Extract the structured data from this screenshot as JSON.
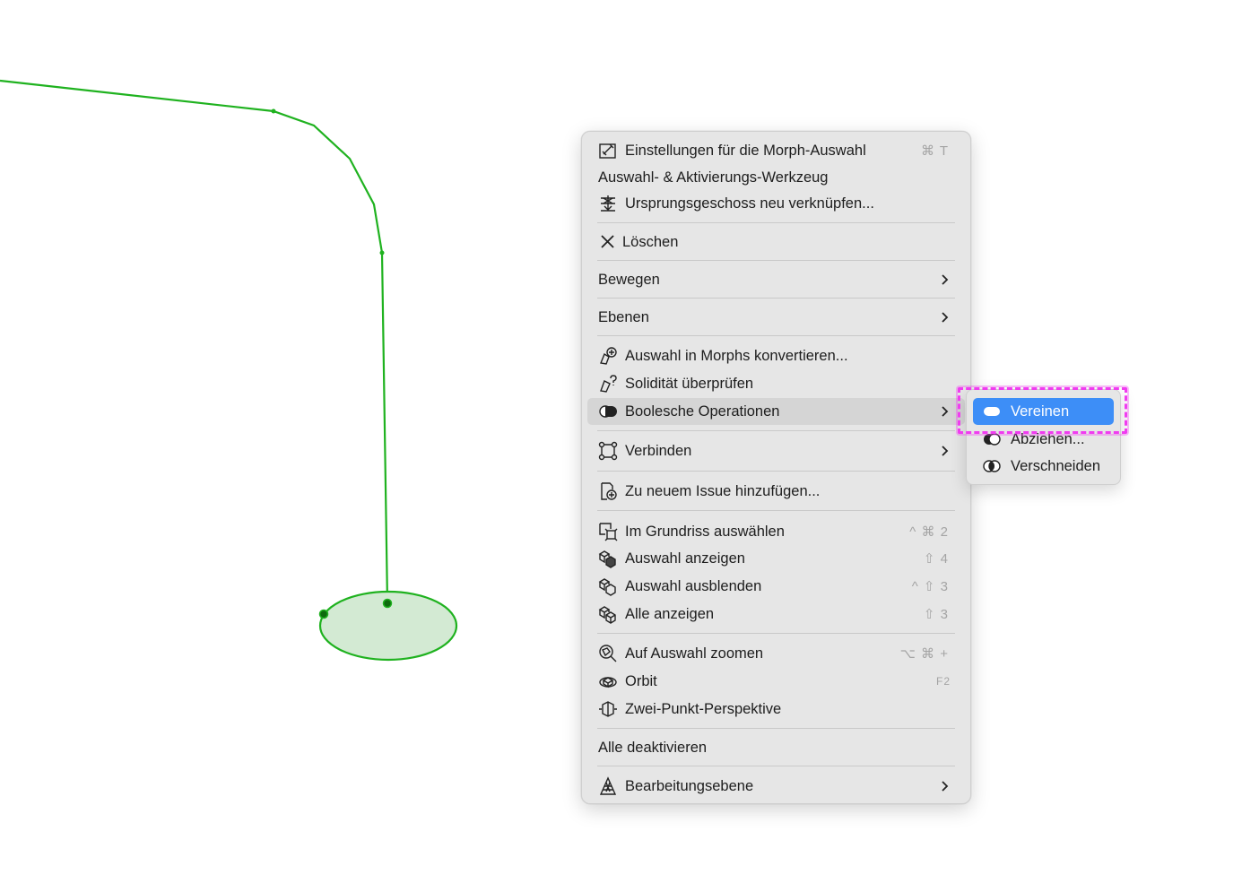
{
  "canvas": {
    "line_color": "#1fb21f",
    "fill_color": "#d3ead3"
  },
  "menu": {
    "items": [
      {
        "label": "Einstellungen für die Morph-Auswahl",
        "shortcut": "⌘ T",
        "icon": "morph-settings-icon"
      },
      {
        "label": "Auswahl- & Aktivierungs-Werkzeug"
      },
      {
        "label": "Ursprungsgeschoss neu verknüpfen...",
        "icon": "relink-story-icon"
      },
      {
        "label": "Löschen",
        "icon": "close-icon"
      },
      {
        "label": "Bewegen",
        "submenu": true
      },
      {
        "label": "Ebenen",
        "submenu": true
      },
      {
        "label": "Auswahl in Morphs konvertieren...",
        "icon": "convert-morph-icon"
      },
      {
        "label": "Solidität überprüfen",
        "icon": "check-solidity-icon"
      },
      {
        "label": "Boolesche Operationen",
        "icon": "boolean-icon",
        "submenu": true
      },
      {
        "label": "Verbinden",
        "icon": "connect-icon",
        "submenu": true
      },
      {
        "label": "Zu neuem Issue hinzufügen...",
        "icon": "add-issue-icon"
      },
      {
        "label": "Im Grundriss auswählen",
        "shortcut": "^ ⌘ 2",
        "icon": "floorplan-select-icon"
      },
      {
        "label": "Auswahl anzeigen",
        "shortcut": "⇧ 4",
        "icon": "show-selection-icon"
      },
      {
        "label": "Auswahl ausblenden",
        "shortcut": "^ ⇧ 3",
        "icon": "hide-selection-icon"
      },
      {
        "label": "Alle anzeigen",
        "shortcut": "⇧ 3",
        "icon": "show-all-icon"
      },
      {
        "label": "Auf Auswahl zoomen",
        "shortcut": "⌥ ⌘ +",
        "icon": "zoom-selection-icon"
      },
      {
        "label": "Orbit",
        "shortcut": "F2",
        "icon": "orbit-icon"
      },
      {
        "label": "Zwei-Punkt-Perspektive",
        "icon": "two-point-perspective-icon"
      },
      {
        "label": "Alle deaktivieren"
      },
      {
        "label": "Bearbeitungsebene",
        "icon": "edit-plane-icon",
        "submenu": true
      }
    ]
  },
  "submenu": {
    "items": [
      {
        "label": "Vereinen",
        "icon": "union-icon"
      },
      {
        "label": "Abziehen...",
        "icon": "subtract-icon"
      },
      {
        "label": "Verschneiden",
        "icon": "intersect-icon"
      }
    ]
  },
  "accent": "#3d8ef7",
  "highlight_color": "#f03cf0"
}
